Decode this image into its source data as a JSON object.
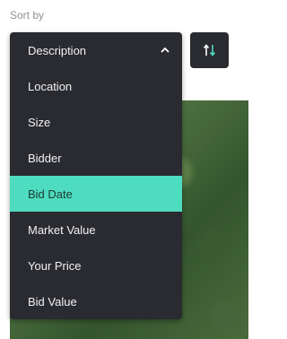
{
  "sort": {
    "label": "Sort by",
    "selected_label": "Description",
    "toggle_icon": "sort-direction-icon",
    "options": [
      "Location",
      "Size",
      "Bidder",
      "Bid Date",
      "Market Value",
      "Your Price",
      "Bid Value"
    ],
    "highlighted_option": "Bid Date"
  },
  "colors": {
    "dropdown_bg": "#2a2b30",
    "highlight": "#4ddcbf",
    "arrow_up": "#ffffff",
    "arrow_down": "#4ddcbf"
  }
}
